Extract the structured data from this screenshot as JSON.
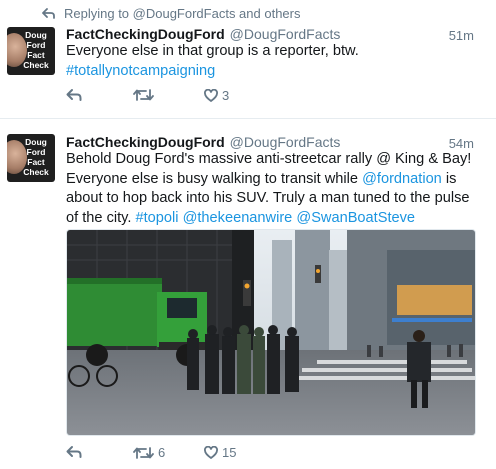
{
  "reply_context": {
    "text": "Replying to @DougFordFacts and others"
  },
  "tweets": [
    {
      "avatar_text": [
        "Doug",
        "Ford",
        "Fact",
        "Check"
      ],
      "name": "FactCheckingDougFord",
      "handle": "@DougFordFacts",
      "time": "51m",
      "text_plain": "Everyone else in that group is a reporter, btw.",
      "hashtag": "#totallynotcampaigning",
      "actions": {
        "reply": "",
        "retweet": "",
        "like": "3"
      }
    },
    {
      "avatar_text": [
        "Doug",
        "Ford",
        "Fact",
        "Check"
      ],
      "name": "FactCheckingDougFord",
      "handle": "@DougFordFacts",
      "time": "54m",
      "text_part1": "Behold Doug Ford's massive anti-streetcar rally @ King & Bay! Everyone else is busy walking to transit while ",
      "mention": "@fordnation",
      "text_part2": " is about to hop back into his SUV. Truly a man tuned to the pulse of the city. ",
      "links": [
        "#topoli",
        "@thekeenanwire",
        "@SwanBoatSteve"
      ],
      "actions": {
        "reply": "",
        "retweet": "6",
        "like": "15"
      }
    }
  ],
  "colors": {
    "link": "#1b95e0",
    "meta": "#657786",
    "text": "#14171a",
    "divider": "#e6ecf0"
  },
  "icons": [
    "reply-arrow-icon",
    "reply-icon",
    "retweet-icon",
    "heart-icon"
  ]
}
